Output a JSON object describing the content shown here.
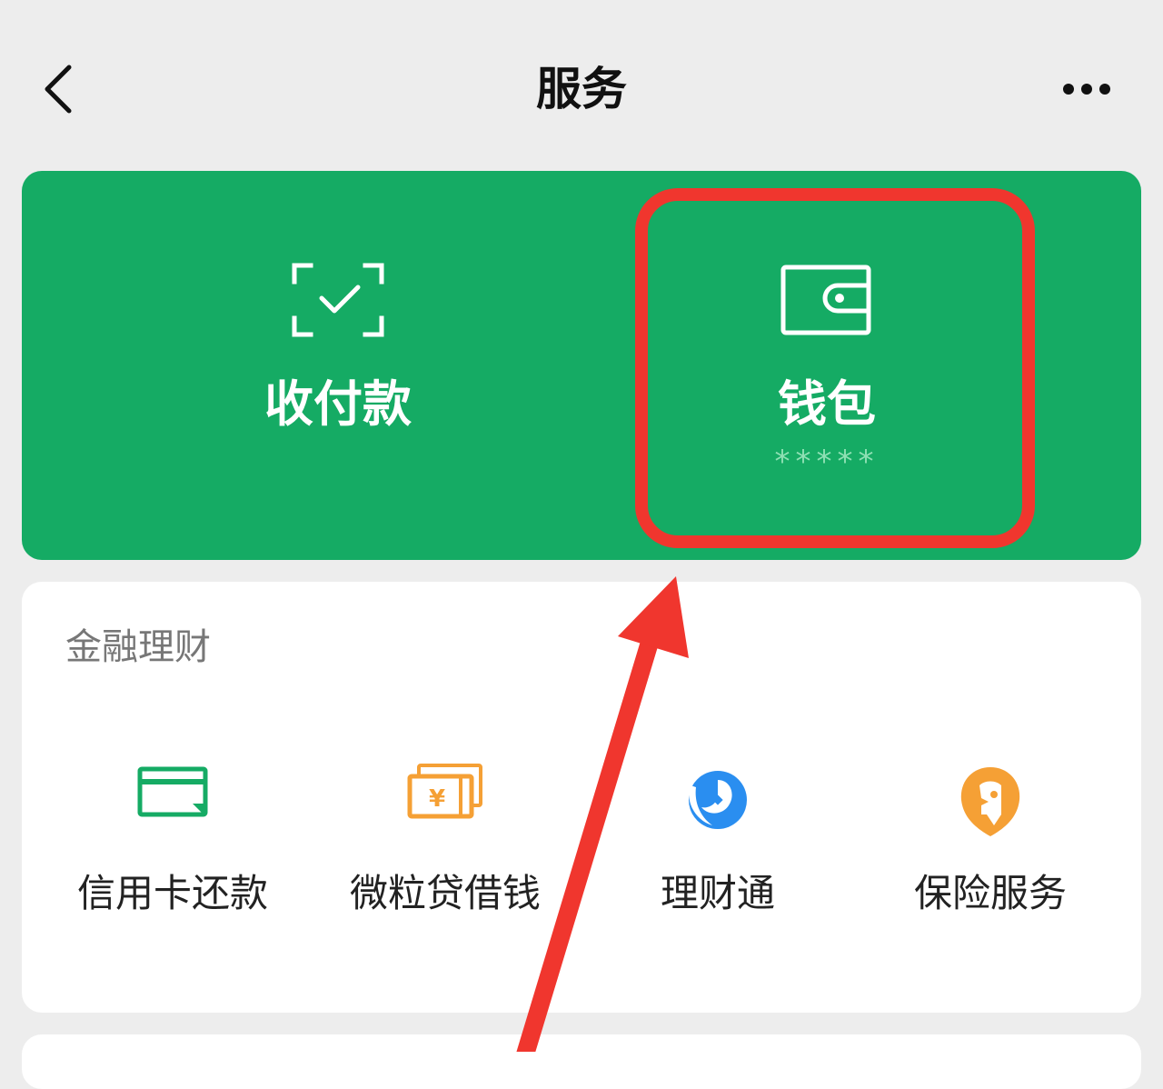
{
  "header": {
    "title": "服务"
  },
  "top_card": {
    "pay_label": "收付款",
    "wallet_label": "钱包",
    "wallet_balance": "*****"
  },
  "finance": {
    "section_title": "金融理财",
    "items": [
      {
        "label": "信用卡还款",
        "icon": "credit-card-icon",
        "color": "#15ab64"
      },
      {
        "label": "微粒贷借钱",
        "icon": "loan-icon",
        "color": "#f5a035"
      },
      {
        "label": "理财通",
        "icon": "licaitong-icon",
        "color": "#2a8ef0"
      },
      {
        "label": "保险服务",
        "icon": "insurance-icon",
        "color": "#f5a035"
      }
    ]
  },
  "colors": {
    "brand_green": "#15ab64",
    "annotation_red": "#f0362e",
    "background": "#ededed"
  }
}
